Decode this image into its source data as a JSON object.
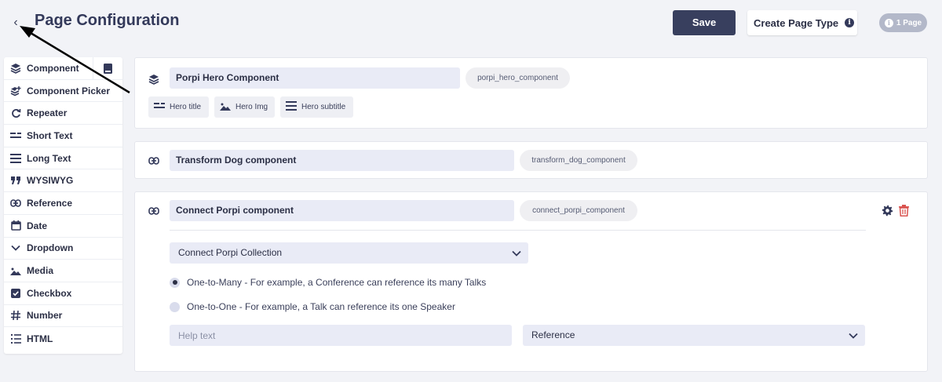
{
  "header": {
    "back_glyph": "‹",
    "title": "Page Configuration",
    "save_label": "Save",
    "create_label": "Create Page Type",
    "badge_label": "1 Page"
  },
  "sidebar": {
    "items": [
      {
        "label": "Component",
        "icon": "layers-icon"
      },
      {
        "label": "Component Picker",
        "icon": "layers-plus-icon"
      },
      {
        "label": "Repeater",
        "icon": "repeat-icon"
      },
      {
        "label": "Short Text",
        "icon": "short-text-icon"
      },
      {
        "label": "Long Text",
        "icon": "long-text-icon"
      },
      {
        "label": "WYSIWYG",
        "icon": "quote-icon"
      },
      {
        "label": "Reference",
        "icon": "link-icon"
      },
      {
        "label": "Date",
        "icon": "calendar-icon"
      },
      {
        "label": "Dropdown",
        "icon": "chevron-down-icon"
      },
      {
        "label": "Media",
        "icon": "image-icon"
      },
      {
        "label": "Checkbox",
        "icon": "checkbox-icon"
      },
      {
        "label": "Number",
        "icon": "hash-icon"
      },
      {
        "label": "HTML",
        "icon": "list-icon"
      }
    ]
  },
  "cards": [
    {
      "name": "Porpi Hero Component",
      "key": "porpi_hero_component",
      "chips": [
        "Hero title",
        "Hero Img",
        "Hero subtitle"
      ]
    },
    {
      "name": "Transform Dog component",
      "key": "transform_dog_component"
    },
    {
      "name": "Connect Porpi component",
      "key": "connect_porpi_component",
      "collection": "Connect Porpi Collection",
      "radios": [
        {
          "label": "One-to-Many - For example, a Conference can reference its many Talks",
          "selected": true
        },
        {
          "label": "One-to-One - For example, a Talk can reference its one Speaker",
          "selected": false
        }
      ],
      "help_placeholder": "Help text",
      "type_value": "Reference"
    }
  ],
  "colors": {
    "primary": "#383f5e",
    "danger": "#d9534f",
    "field_bg": "#e9ebf6",
    "page_bg": "#f2f3f7"
  }
}
